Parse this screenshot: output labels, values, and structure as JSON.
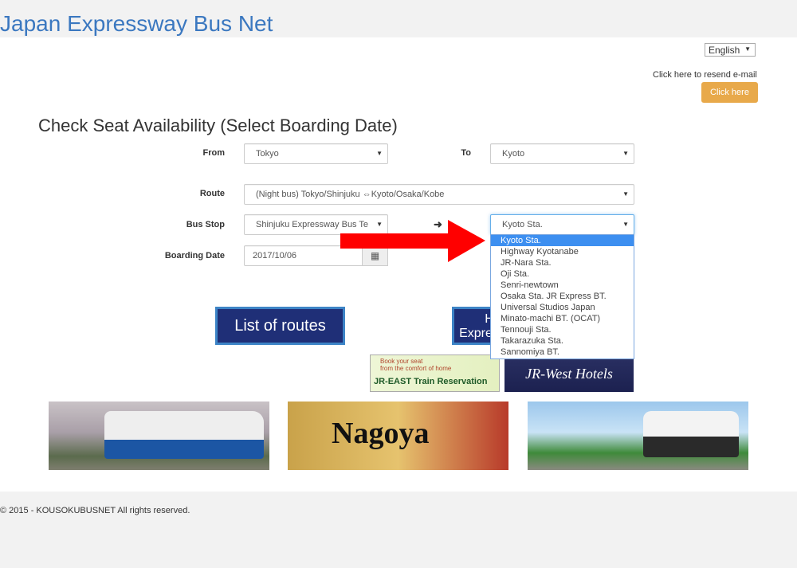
{
  "site_title": "Japan Expressway Bus Net",
  "language": {
    "selected": "English"
  },
  "resend": {
    "text": "Click here to resend e-mail",
    "button": "Click here",
    "button_color": "#e8a94a"
  },
  "page_title": "Check Seat Availability (Select Boarding Date)",
  "form": {
    "from_label": "From",
    "from_value": "Tokyo",
    "to_label": "To",
    "to_value": "Kyoto",
    "route_label": "Route",
    "route_value": "(Night bus) Tokyo/Shinjuku ⇔Kyoto/Osaka/Kobe",
    "busstop_label": "Bus Stop",
    "busstop_from": "Shinjuku Expressway Bus Te",
    "busstop_arrow": "➜",
    "busstop_to": "Kyoto Sta.",
    "date_label": "Boarding Date",
    "date_value": "2017/10/06"
  },
  "dropdown_options": [
    "Kyoto Sta.",
    "Highway Kyotanabe",
    "JR-Nara Sta.",
    "Oji Sta.",
    "Senri-newtown",
    "Osaka Sta. JR Express BT.",
    "Universal Studios Japan",
    "Minato-machi BT. (OCAT)",
    "Tennouji Sta.",
    "Takarazuka Sta.",
    "Sannomiya BT."
  ],
  "buttons": {
    "list_routes": "List of routes",
    "highway_line1": "H",
    "highway_line2": "Expre"
  },
  "banners": {
    "jr_east_top": "Book your seat",
    "jr_east_mid": "from the comfort of home",
    "jr_east_bottom": "JR-EAST Train Reservation",
    "jr_west": "JR-West Hotels",
    "nagoya": "Nagoya"
  },
  "footer": "© 2015 - KOUSOKUBUSNET All rights reserved."
}
